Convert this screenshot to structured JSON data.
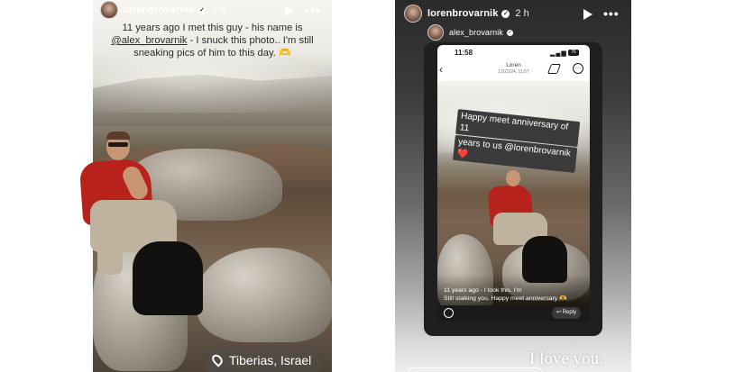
{
  "left_story": {
    "username": "lorenbrovarnik",
    "time": "2 h",
    "caption": {
      "line1": "11 years ago I met this guy - his name is",
      "mention": "@alex_brovarnik",
      "line2_rest": " - I snuck this photo.. I'm still",
      "line3": "sneaking pics of him to this day. 🫶"
    },
    "location": "Tiberias, Israel"
  },
  "right_story": {
    "username": "lorenbrovarnik",
    "time": "2 h",
    "reshared_username": "alex_brovarnik",
    "phone": {
      "status_time": "11:58",
      "battery": "76",
      "chat_name": "Loren",
      "chat_date": "12/22/24, 11:57",
      "sticker_lines": [
        "Happy meet anniversary of 11",
        "years to us @lorenbrovarnik ❤️"
      ],
      "caption_line1": "11 years ago - I took this. I'm",
      "caption_line2": "Still stalking you. Happy meet anniversary 🫶",
      "reply_label": "Reply"
    },
    "footer_text": "I love you."
  }
}
